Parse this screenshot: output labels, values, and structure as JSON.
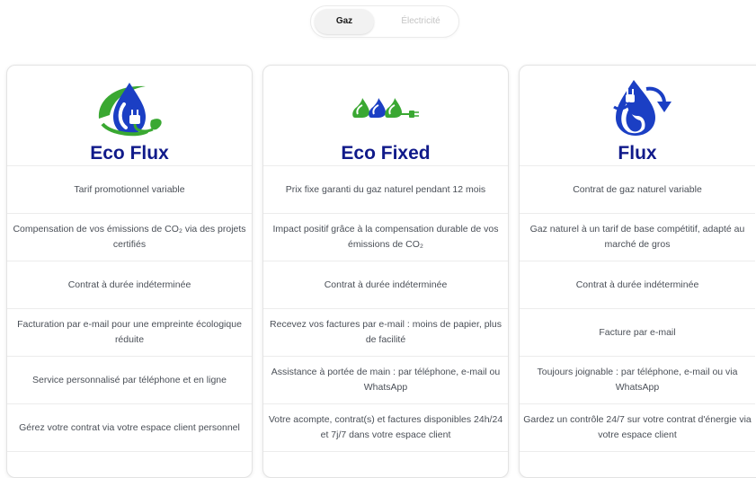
{
  "tabs": {
    "gas": "Gaz",
    "electricity": "Électricité"
  },
  "colors": {
    "title": "#101a8a",
    "green": "#3aa832",
    "blue": "#1b3fc4"
  },
  "cards": [
    {
      "title": "Eco Flux",
      "icon": "water-drop-plug-leaf-icon",
      "features": [
        "Tarif promotionnel variable",
        "Compensation de vos émissions de CO₂ via des projets certifiés",
        "Contrat à durée indéterminée",
        "Facturation par e-mail pour une empreinte écologique réduite",
        "Service personnalisé par téléphone et en ligne",
        "Gérez votre contrat via votre espace client personnel"
      ]
    },
    {
      "title": "Eco Fixed",
      "icon": "three-drops-plug-icon",
      "features": [
        "Prix fixe garanti du gaz naturel pendant 12 mois",
        "Impact positif grâce à la compensation durable de vos émissions de CO₂",
        "Contrat à durée indéterminée",
        "Recevez vos factures par e-mail : moins de papier, plus de facilité",
        "Assistance à portée de main : par téléphone, e-mail ou WhatsApp",
        "Votre acompte, contrat(s) et factures disponibles 24h/24 et 7j/7 dans votre espace client"
      ]
    },
    {
      "title": "Flux",
      "icon": "flame-drop-plug-icon",
      "features": [
        "Contrat de gaz naturel variable",
        "Gaz naturel à un tarif de base compétitif, adapté au marché de gros",
        "Contrat à durée indéterminée",
        "Facture par e-mail",
        "Toujours joignable : par téléphone, e-mail ou via WhatsApp",
        "Gardez un contrôle 24/7 sur votre contrat d'énergie via votre espace client"
      ]
    }
  ]
}
